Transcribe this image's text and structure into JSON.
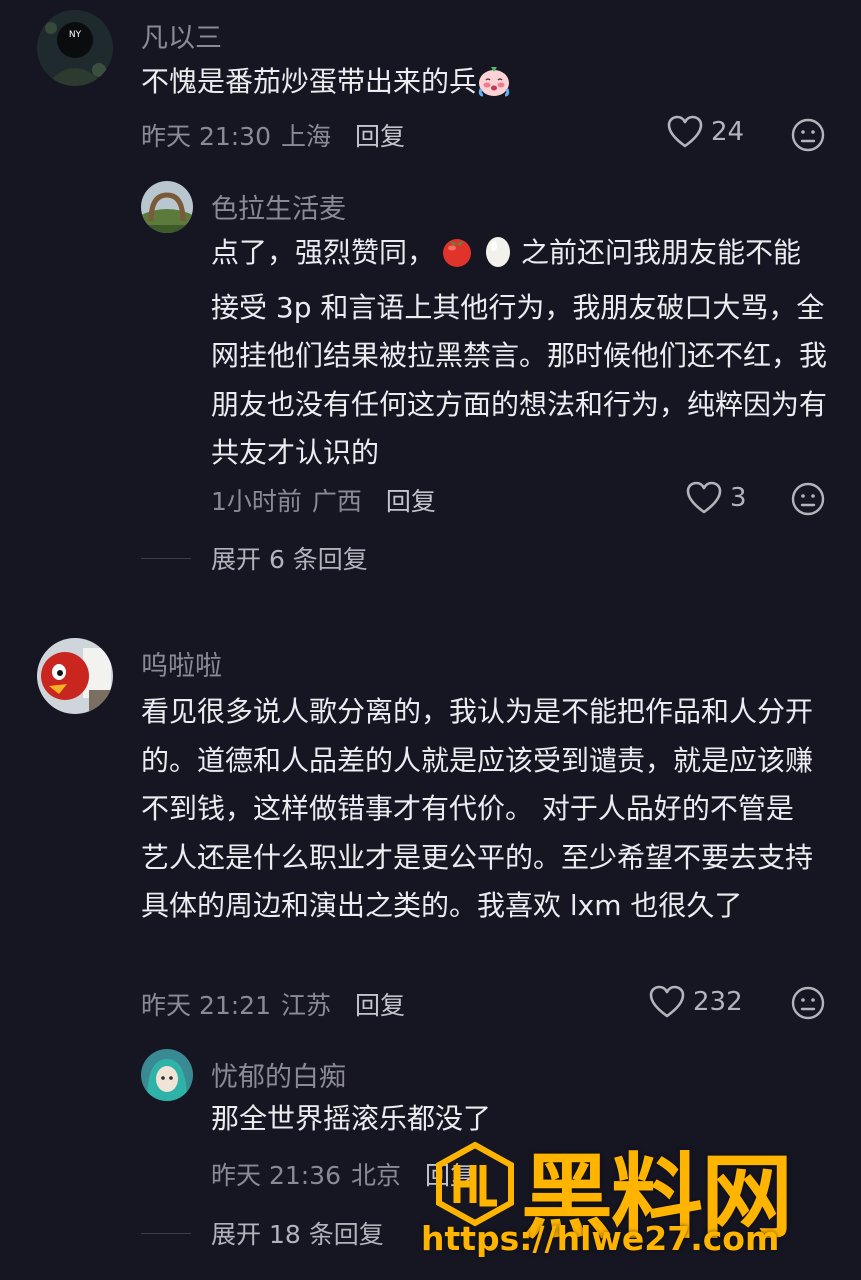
{
  "comments": [
    {
      "username": "凡以三",
      "text": "不愧是番茄炒蛋带出来的兵",
      "emoji": "crying-face",
      "time": "昨天 21:30",
      "location": "上海",
      "reply": "回复",
      "likes": "24"
    },
    {
      "username": "色拉生活麦",
      "text_before": "点了，强烈赞同，",
      "emojis": [
        "tomato",
        "egg"
      ],
      "text_after": "之前还问我朋友能不能接受 3p 和言语上其他行为，我朋友破口大骂，全网挂他们结果被拉黑禁言。那时候他们还不红，我朋友也没有任何这方面的想法和行为，纯粹因为有共友才认识的",
      "time": "1小时前",
      "location": "广西",
      "reply": "回复",
      "likes": "3"
    },
    {
      "username": "呜啦啦",
      "text": "看见很多说人歌分离的，我认为是不能把作品和人分开的。道德和人品差的人就是应该受到谴责，就是应该赚不到钱，这样做错事才有代价。 对于人品好的不管是艺人还是什么职业才是更公平的。至少希望不要去支持具体的周边和演出之类的。我喜欢 lxm 也很久了",
      "time": "昨天 21:21",
      "location": "江苏",
      "reply": "回复",
      "likes": "232"
    },
    {
      "username": "忧郁的白痴",
      "text": "那全世界摇滚乐都没了",
      "time": "昨天 21:36",
      "location": "北京",
      "reply": "回复"
    }
  ],
  "expand": [
    {
      "label": "展开 6 条回复"
    },
    {
      "label": "展开 18 条回复"
    }
  ],
  "watermark": {
    "title": "黑料网",
    "url": "https://hlwe27.com",
    "color": "#ffb400"
  },
  "colors": {
    "background": "#161622",
    "text": "#ecebf0",
    "muted": "#8b8a94"
  }
}
